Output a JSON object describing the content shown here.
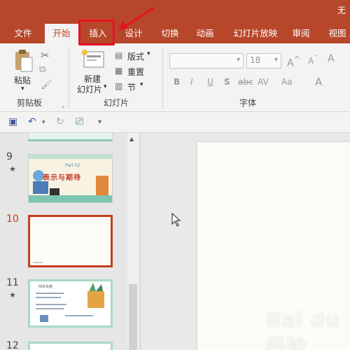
{
  "titlebar": {
    "corner_text": "无"
  },
  "tabs": [
    {
      "label": "文件"
    },
    {
      "label": "开始"
    },
    {
      "label": "插入"
    },
    {
      "label": "设计"
    },
    {
      "label": "切换"
    },
    {
      "label": "动画"
    },
    {
      "label": "幻灯片放映"
    },
    {
      "label": "审阅"
    },
    {
      "label": "视图"
    }
  ],
  "ribbon": {
    "clipboard": {
      "paste": "粘贴",
      "group": "剪贴板"
    },
    "slides": {
      "new_slide_line1": "新建",
      "new_slide_line2": "幻灯片",
      "layout": "版式",
      "reset": "重置",
      "section": "节",
      "group": "幻灯片"
    },
    "font": {
      "font_size": "18",
      "group": "字体",
      "bold": "B",
      "italic": "I",
      "underline": "U",
      "shadow": "S",
      "strike": "abc",
      "spacing": "AV",
      "case": "Aa",
      "color": "A"
    }
  },
  "thumbnails": [
    {
      "number": "9",
      "starred": true,
      "title": "Part 02",
      "text": "表示与期待"
    },
    {
      "number": "10",
      "starred": false,
      "selected": true
    },
    {
      "number": "11",
      "starred": true,
      "heading": "简单有趣"
    },
    {
      "number": "12",
      "starred": false
    }
  ],
  "watermark": "Bai du 经验",
  "colors": {
    "accent": "#b7472a",
    "highlight": "#e81123"
  }
}
